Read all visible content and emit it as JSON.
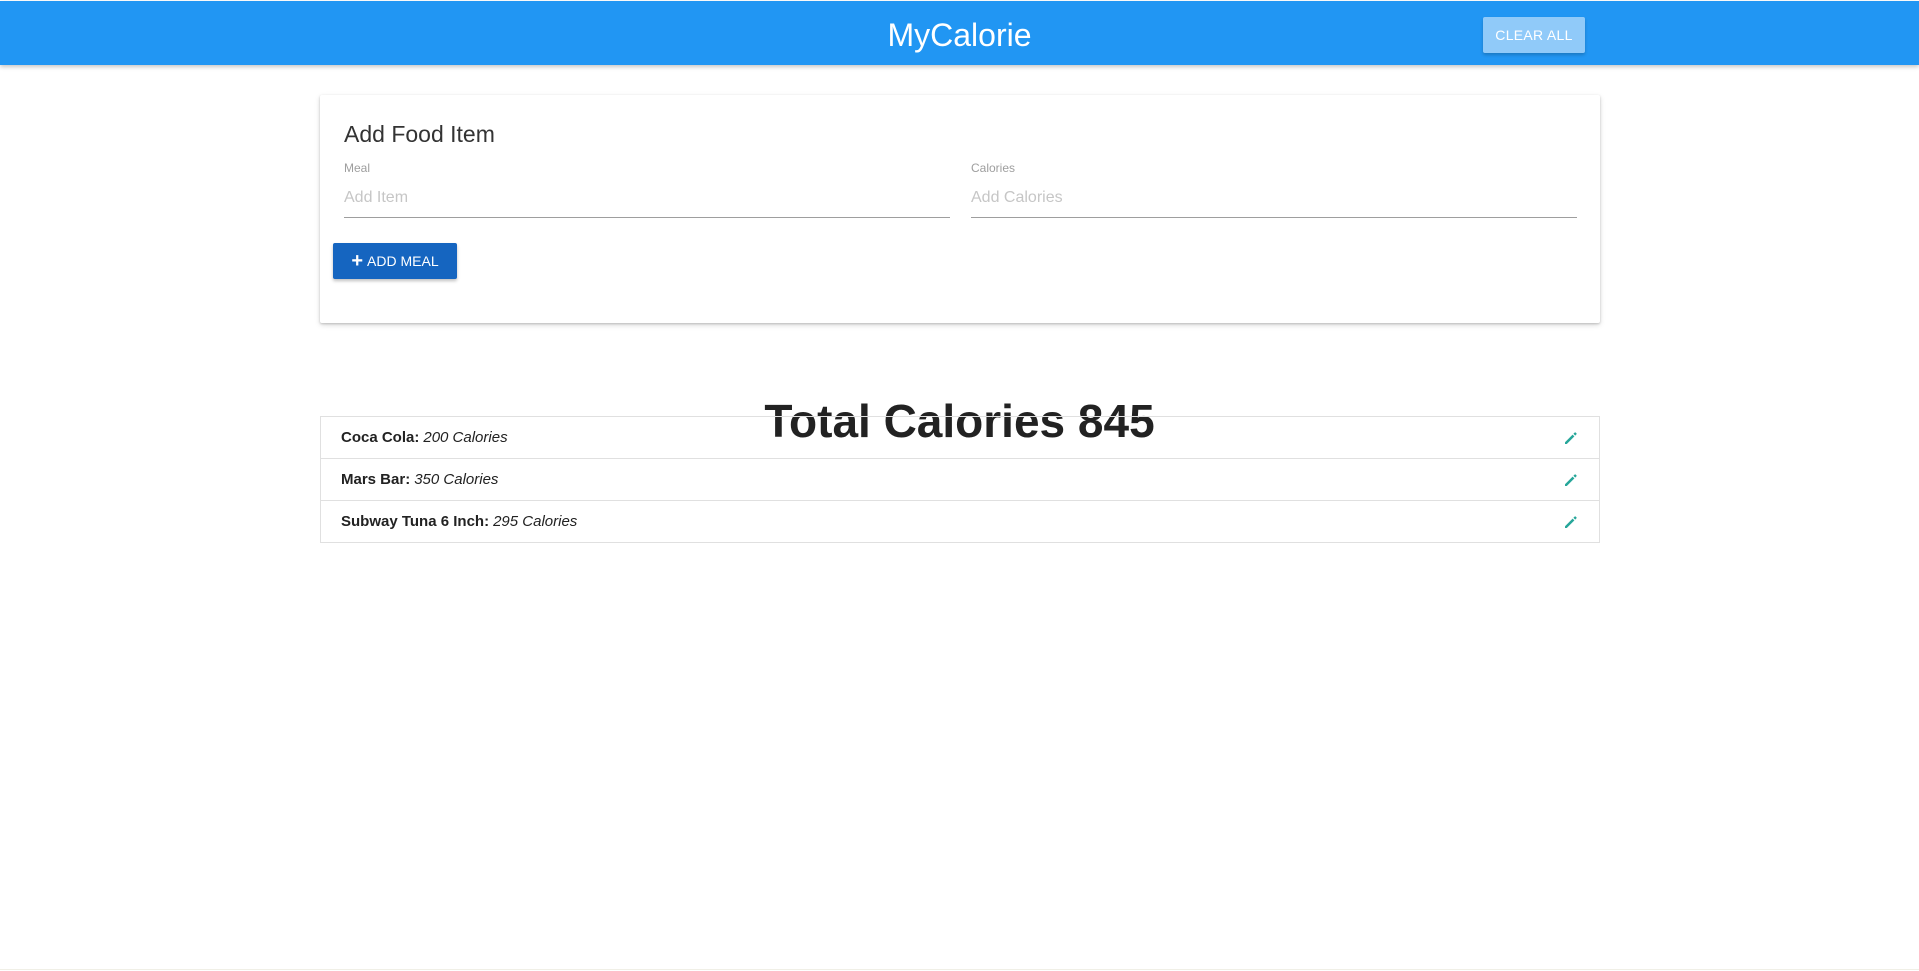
{
  "navbar": {
    "brand": "MyCalorie",
    "clear_all_label": "CLEAR ALL"
  },
  "form": {
    "title": "Add Food Item",
    "meal_label": "Meal",
    "meal_placeholder": "Add Item",
    "meal_value": "",
    "calories_label": "Calories",
    "calories_placeholder": "Add Calories",
    "calories_value": "",
    "add_button_icon": "plus-icon",
    "add_button_label": "ADD MEAL"
  },
  "total": {
    "text": "Total Calories 845"
  },
  "items": [
    {
      "name": "Coca Cola:",
      "calories": "200 Calories",
      "icon": "pencil-icon"
    },
    {
      "name": "Mars Bar:",
      "calories": "350 Calories",
      "icon": "pencil-icon"
    },
    {
      "name": "Subway Tuna 6 Inch:",
      "calories": "295 Calories",
      "icon": "pencil-icon"
    }
  ],
  "colors": {
    "navbar": "#2196f3",
    "clear_button": "#90caf9",
    "add_button": "#1565c0",
    "edit_icon": "#26a69a"
  }
}
